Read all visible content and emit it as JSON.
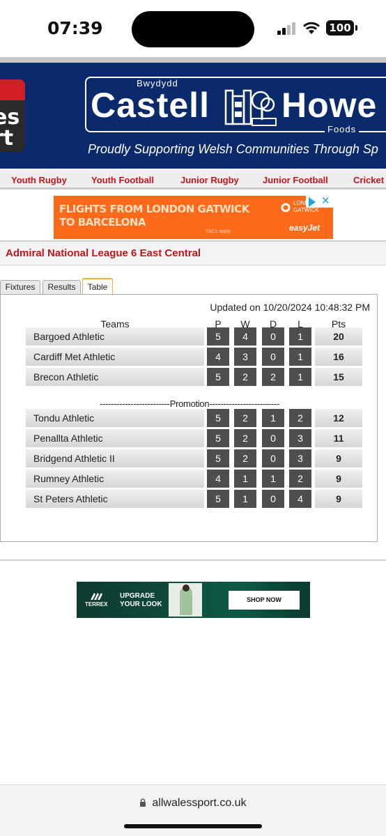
{
  "status_bar": {
    "time": "07:39",
    "battery": "100"
  },
  "banner": {
    "logo_text": "es\nrt",
    "sponsor_small": "Bwydydd",
    "sponsor_name_left": "Castell",
    "sponsor_name_right": "Howe",
    "sponsor_foods": "Foods",
    "tagline": "Proudly Supporting Welsh Communities Through Sp"
  },
  "nav": {
    "items": [
      {
        "label": "Youth Rugby"
      },
      {
        "label": "Youth Football"
      },
      {
        "label": "Junior Rugby"
      },
      {
        "label": "Junior Football"
      },
      {
        "label": "Cricket"
      }
    ]
  },
  "ad_top": {
    "headline": "FLIGHTS FROM LONDON GATWICK\nTO BARCELONA",
    "tc": "T&Cs apply",
    "gatwick": "LONDON\nGATWICK",
    "brand": "easyJet"
  },
  "league": {
    "title": "Admiral National League 6 East Central",
    "tabs": [
      {
        "label": "Fixtures",
        "active": false
      },
      {
        "label": "Results",
        "active": false
      },
      {
        "label": "Table",
        "active": true
      }
    ],
    "updated": "Updated on 10/20/2024 10:48:32 PM",
    "columns": {
      "team": "Teams",
      "p": "P",
      "w": "W",
      "d": "D",
      "l": "L",
      "pts": "Pts"
    },
    "promotion_label": "-------------------------Promotion-------------------------",
    "rows": [
      {
        "team": "Bargoed Athletic",
        "p": "5",
        "w": "4",
        "d": "0",
        "l": "1",
        "pts": "20"
      },
      {
        "team": "Cardiff Met Athletic",
        "p": "4",
        "w": "3",
        "d": "0",
        "l": "1",
        "pts": "16"
      },
      {
        "team": "Brecon Athletic",
        "p": "5",
        "w": "2",
        "d": "2",
        "l": "1",
        "pts": "15"
      },
      {
        "team": "Tondu Athletic",
        "p": "5",
        "w": "2",
        "d": "1",
        "l": "2",
        "pts": "12"
      },
      {
        "team": "Penallta Athletic",
        "p": "5",
        "w": "2",
        "d": "0",
        "l": "3",
        "pts": "11"
      },
      {
        "team": "Bridgend Athletic II",
        "p": "5",
        "w": "2",
        "d": "0",
        "l": "3",
        "pts": "9"
      },
      {
        "team": "Rumney Athletic",
        "p": "4",
        "w": "1",
        "d": "1",
        "l": "2",
        "pts": "9"
      },
      {
        "team": "St Peters Athletic",
        "p": "5",
        "w": "1",
        "d": "0",
        "l": "4",
        "pts": "9"
      }
    ]
  },
  "ad_bottom": {
    "brand": "TERREX",
    "headline": "UPGRADE\nYOUR LOOK",
    "cta": "SHOP NOW"
  },
  "browser": {
    "url": "allwalessport.co.uk"
  },
  "colors": {
    "banner_blue": "#0a2a6b",
    "nav_red": "#c0161c",
    "ad_orange": "#ff6a1a",
    "cell_dark": "#4e4e4e"
  }
}
